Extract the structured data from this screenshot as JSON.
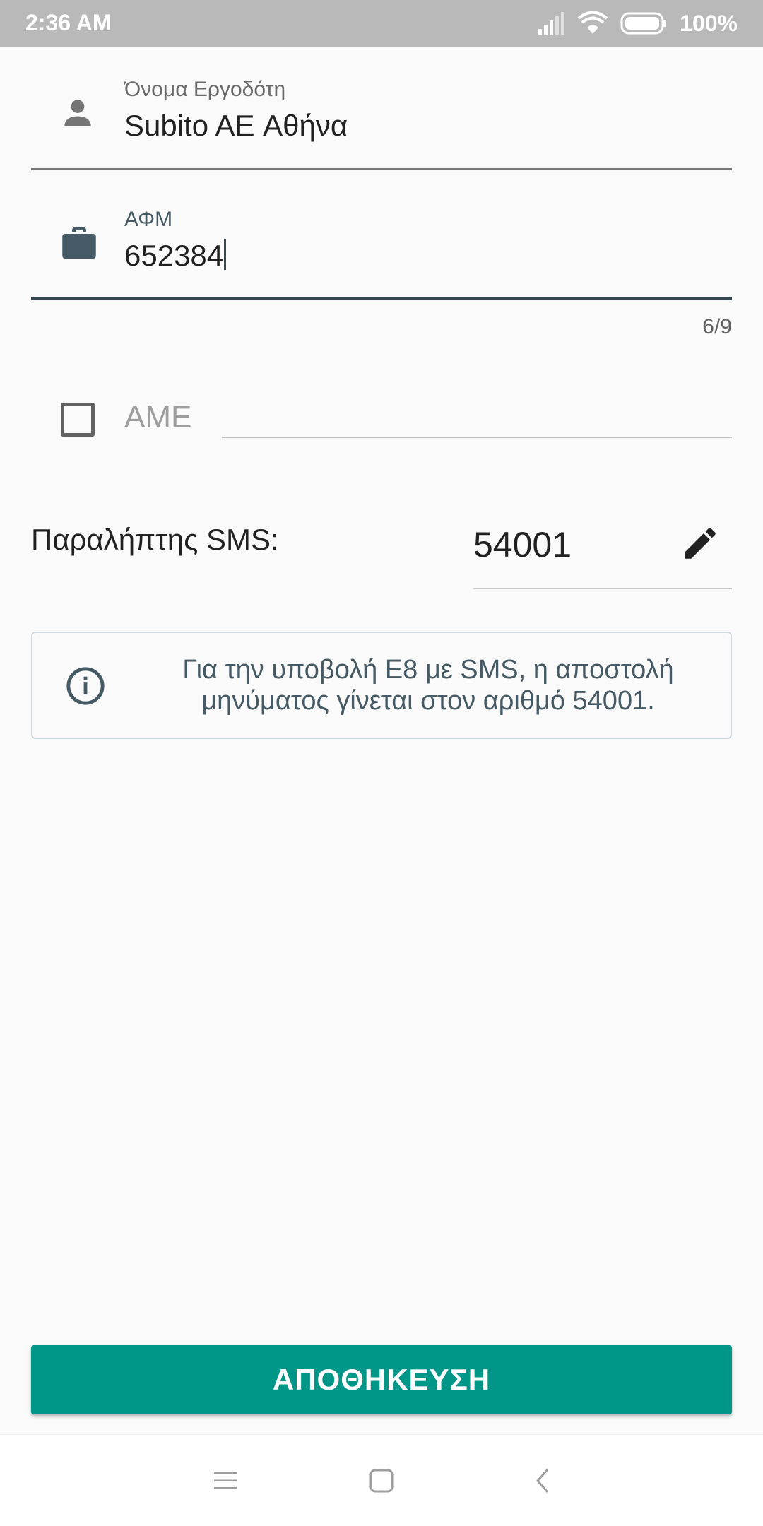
{
  "status_bar": {
    "time": "2:36 AM",
    "battery": "100%",
    "icons": [
      "signal-icon",
      "wifi-icon",
      "battery-icon"
    ]
  },
  "employer_name": {
    "label": "Όνομα Εργοδότη",
    "value": "Subito AE Αθήνα",
    "icon": "person-icon"
  },
  "afm": {
    "label": "ΑΦΜ",
    "value": "652384",
    "counter": "6/9",
    "icon": "briefcase-icon"
  },
  "ame": {
    "label": "ΑΜΕ",
    "checked": false
  },
  "sms": {
    "label": "Παραλήπτης SMS:",
    "value": "54001",
    "edit_icon": "pencil-icon"
  },
  "info": {
    "icon": "info-icon",
    "line1": "Για την υποβολή Ε8 με SMS, η αποστολή",
    "line2": "μηνύματος γίνεται στον αριθμό 54001."
  },
  "save_button": {
    "label": "ΑΠΟΘΗΚΕΥΣΗ"
  },
  "nav_bar": {
    "icons": [
      "menu-icon",
      "home-icon",
      "back-icon"
    ]
  },
  "colors": {
    "accent": "#009688",
    "focused_field": "#37474F",
    "status_bar": "#B9B9B9"
  }
}
